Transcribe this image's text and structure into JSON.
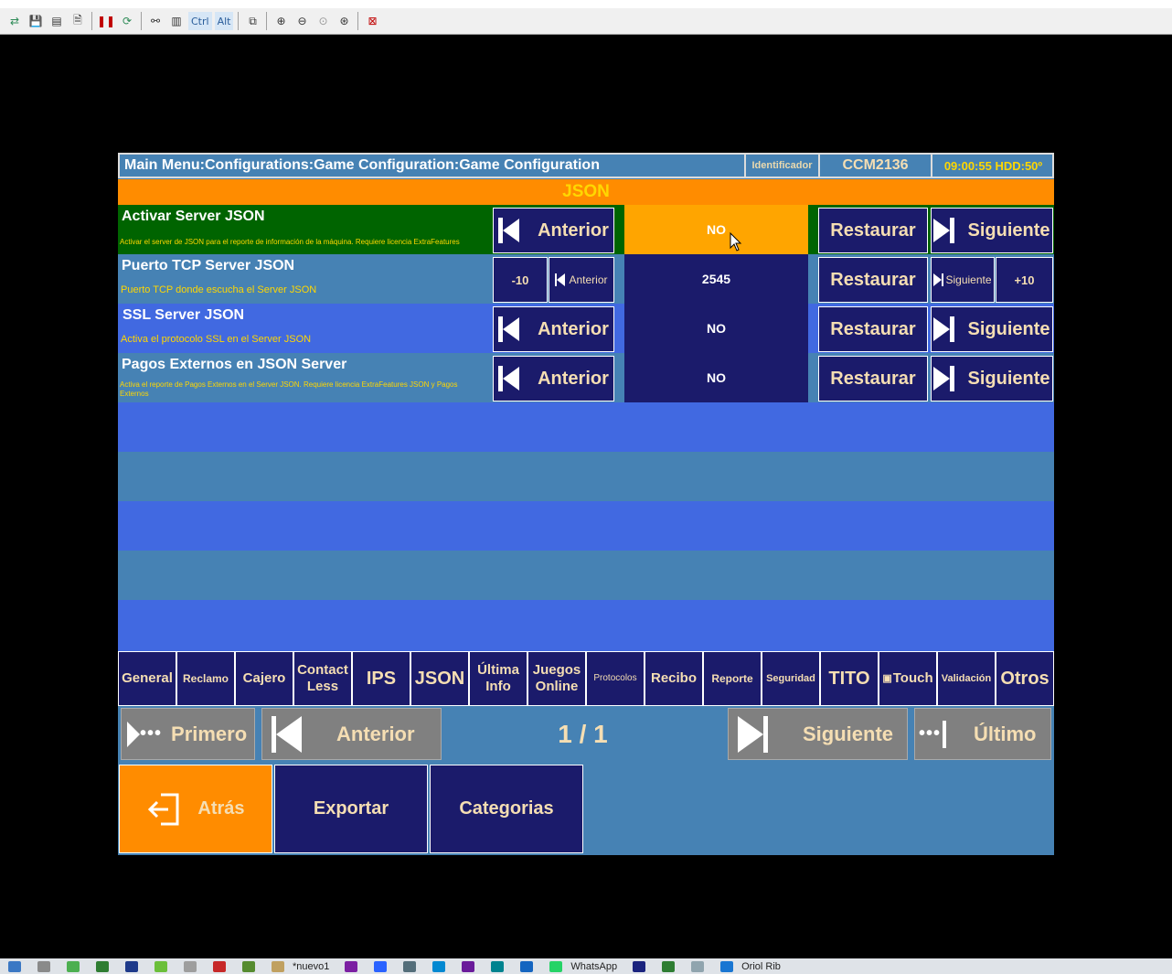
{
  "toolbar": {
    "key_ctrl": "Ctrl",
    "key_alt": "Alt",
    "icons": [
      "export-icon",
      "save-icon",
      "copy-doc-icon",
      "info-doc-icon",
      "pause-icon",
      "refresh-icon",
      "binoculars-icon",
      "search-doc-icon",
      "ctrl-key-icon",
      "alt-key-icon",
      "clipboard-icon",
      "zoom-in-icon",
      "zoom-out-icon",
      "zoom-fit-icon",
      "zoom-custom-icon",
      "fullscreen-icon"
    ]
  },
  "header": {
    "path": "Main Menu:Configurations:Game Configuration:Game Configuration",
    "ident_label": "Identificador",
    "ident_value": "CCM2136",
    "clock": "09:00:55 HDD:50º"
  },
  "section": {
    "title": "JSON"
  },
  "rows": [
    {
      "title": "Activar Server JSON",
      "desc": "Activar el server de JSON para el reporte de información de la máquina. Requiere licencia ExtraFeatures",
      "prev": "Anterior",
      "value": "NO",
      "restore": "Restaurar",
      "next": "Siguiente"
    },
    {
      "title": "Puerto TCP Server JSON",
      "desc": "Puerto TCP donde escucha el Server JSON",
      "minus10": "-10",
      "prev": "Anterior",
      "value": "2545",
      "restore": "Restaurar",
      "next": "Siguiente",
      "plus10": "+10"
    },
    {
      "title": "SSL Server JSON",
      "desc": "Activa el protocolo SSL en el Server JSON",
      "prev": "Anterior",
      "value": "NO",
      "restore": "Restaurar",
      "next": "Siguiente"
    },
    {
      "title": "Pagos Externos en JSON Server",
      "desc": "Activa el reporte de Pagos Externos en el Server JSON. Requiere licencia ExtraFeatures JSON y Pagos Externos",
      "prev": "Anterior",
      "value": "NO",
      "restore": "Restaurar",
      "next": "Siguiente"
    }
  ],
  "tabs": [
    {
      "l1": "General"
    },
    {
      "l1": "Reclamo"
    },
    {
      "l1": "Cajero"
    },
    {
      "l1": "Contact",
      "l2": "Less"
    },
    {
      "l1": "IPS"
    },
    {
      "l1": "JSON"
    },
    {
      "l1": "Última",
      "l2": "Info"
    },
    {
      "l1": "Juegos",
      "l2": "Online"
    },
    {
      "l1": "Protocolos"
    },
    {
      "l1": "Recibo"
    },
    {
      "l1": "Reporte"
    },
    {
      "l1": "Seguridad"
    },
    {
      "l1": "TITO"
    },
    {
      "l1": "Touch"
    },
    {
      "l1": "Validación"
    },
    {
      "l1": "Otros"
    }
  ],
  "pager": {
    "first": "Primero",
    "prev": "Anterior",
    "indicator": "1 / 1",
    "next": "Siguiente",
    "last": "Último"
  },
  "bottom": {
    "back": "Atrás",
    "export": "Exportar",
    "categories": "Categorias"
  },
  "taskbar": {
    "labels": [
      "*nuevo1",
      "WhatsApp",
      "Oriol Rib"
    ]
  },
  "colors": {
    "panel": "#4682b4",
    "row_alt": "#4169e1",
    "navy": "#1b1b6b",
    "orange": "#ff8c00",
    "green_row": "#006400",
    "gold": "#ffd700",
    "wheat": "#f5deb3"
  }
}
